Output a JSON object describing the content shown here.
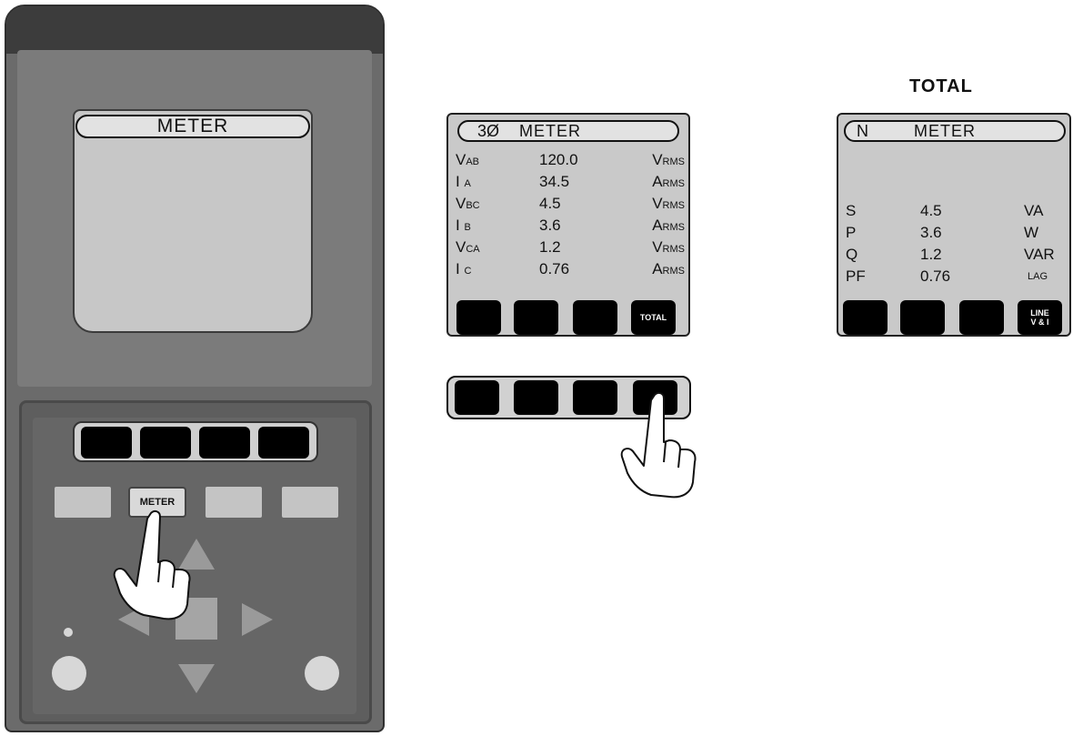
{
  "device": {
    "screen_title": "METER",
    "meter_key_label": "METER"
  },
  "panel1": {
    "title_prefix": "3Ø",
    "title": "METER",
    "rows": [
      {
        "label": "V",
        "sub": "AB",
        "value": "120.0",
        "unit": "V",
        "unit_sub": "RMS"
      },
      {
        "label": "I",
        "sub": "A",
        "value": "34.5",
        "unit": "A",
        "unit_sub": "RMS"
      },
      {
        "label": "V",
        "sub": "BC",
        "value": "4.5",
        "unit": "V",
        "unit_sub": "RMS"
      },
      {
        "label": "I",
        "sub": "B",
        "value": "3.6",
        "unit": "A",
        "unit_sub": "RMS"
      },
      {
        "label": "V",
        "sub": "CA",
        "value": "1.2",
        "unit": "V",
        "unit_sub": "RMS"
      },
      {
        "label": "I",
        "sub": "C",
        "value": "0.76",
        "unit": "A",
        "unit_sub": "RMS"
      }
    ],
    "softkey4_label": "TOTAL"
  },
  "panel2": {
    "heading": "TOTAL",
    "title_prefix": "N",
    "title": "METER",
    "rows": [
      {
        "label": "S",
        "value": "4.5",
        "unit": "VA"
      },
      {
        "label": "P",
        "value": "3.6",
        "unit": "W"
      },
      {
        "label": "Q",
        "value": "1.2",
        "unit": "VAR"
      },
      {
        "label": "PF",
        "value": "0.76",
        "unit": "LAG"
      }
    ],
    "softkey4_line1": "LINE",
    "softkey4_line2": "V & I"
  },
  "icons": [
    "pointing-hand-icon",
    "arrow-up-icon",
    "arrow-down-icon",
    "arrow-left-icon",
    "arrow-right-icon"
  ]
}
